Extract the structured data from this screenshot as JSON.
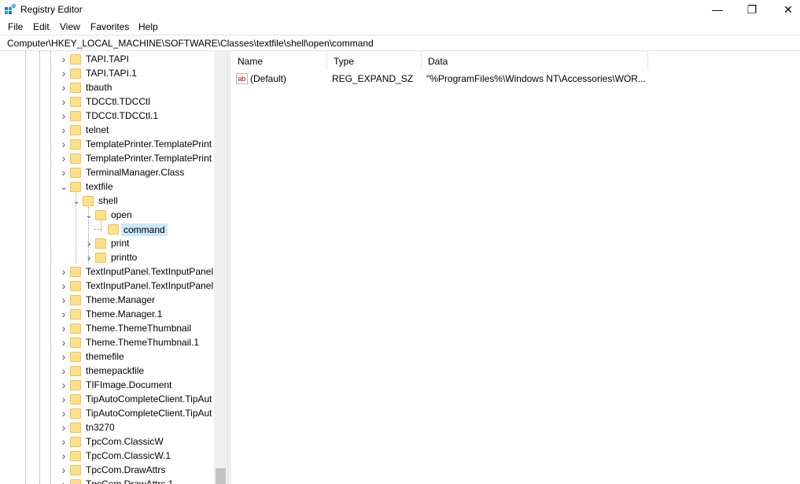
{
  "window": {
    "title": "Registry Editor",
    "controls": {
      "minimize": "—",
      "maximize": "❐",
      "close": "✕"
    }
  },
  "menu": [
    "File",
    "Edit",
    "View",
    "Favorites",
    "Help"
  ],
  "address": "Computer\\HKEY_LOCAL_MACHINE\\SOFTWARE\\Classes\\textfile\\shell\\open\\command",
  "tree": [
    {
      "label": "TAPI.TAPI",
      "level": 0,
      "expander": "collapsed"
    },
    {
      "label": "TAPI.TAPI.1",
      "level": 0,
      "expander": "collapsed"
    },
    {
      "label": "tbauth",
      "level": 0,
      "expander": "collapsed"
    },
    {
      "label": "TDCCtl.TDCCtl",
      "level": 0,
      "expander": "collapsed"
    },
    {
      "label": "TDCCtl.TDCCtl.1",
      "level": 0,
      "expander": "collapsed"
    },
    {
      "label": "telnet",
      "level": 0,
      "expander": "collapsed"
    },
    {
      "label": "TemplatePrinter.TemplatePrint",
      "level": 0,
      "expander": "collapsed"
    },
    {
      "label": "TemplatePrinter.TemplatePrint",
      "level": 0,
      "expander": "collapsed"
    },
    {
      "label": "TerminalManager.Class",
      "level": 0,
      "expander": "collapsed"
    },
    {
      "label": "textfile",
      "level": 0,
      "expander": "expanded"
    },
    {
      "label": "shell",
      "level": 1,
      "expander": "expanded"
    },
    {
      "label": "open",
      "level": 2,
      "expander": "expanded"
    },
    {
      "label": "command",
      "level": 3,
      "expander": "none",
      "selected": true
    },
    {
      "label": "print",
      "level": 2,
      "expander": "collapsed"
    },
    {
      "label": "printto",
      "level": 2,
      "expander": "collapsed"
    },
    {
      "label": "TextInputPanel.TextInputPanel",
      "level": 0,
      "expander": "collapsed"
    },
    {
      "label": "TextInputPanel.TextInputPanel.",
      "level": 0,
      "expander": "collapsed"
    },
    {
      "label": "Theme.Manager",
      "level": 0,
      "expander": "collapsed"
    },
    {
      "label": "Theme.Manager.1",
      "level": 0,
      "expander": "collapsed"
    },
    {
      "label": "Theme.ThemeThumbnail",
      "level": 0,
      "expander": "collapsed"
    },
    {
      "label": "Theme.ThemeThumbnail.1",
      "level": 0,
      "expander": "collapsed"
    },
    {
      "label": "themefile",
      "level": 0,
      "expander": "collapsed"
    },
    {
      "label": "themepackfile",
      "level": 0,
      "expander": "collapsed"
    },
    {
      "label": "TIFImage.Document",
      "level": 0,
      "expander": "collapsed"
    },
    {
      "label": "TipAutoCompleteClient.TipAut",
      "level": 0,
      "expander": "collapsed"
    },
    {
      "label": "TipAutoCompleteClient.TipAut",
      "level": 0,
      "expander": "collapsed"
    },
    {
      "label": "tn3270",
      "level": 0,
      "expander": "collapsed"
    },
    {
      "label": "TpcCom.ClassicW",
      "level": 0,
      "expander": "collapsed"
    },
    {
      "label": "TpcCom.ClassicW.1",
      "level": 0,
      "expander": "collapsed"
    },
    {
      "label": "TpcCom.DrawAttrs",
      "level": 0,
      "expander": "collapsed"
    },
    {
      "label": "TpcCom.DrawAttrs.1",
      "level": 0,
      "expander": "collapsed"
    }
  ],
  "list": {
    "columns": [
      "Name",
      "Type",
      "Data"
    ],
    "rows": [
      {
        "icon": "ab",
        "name": "(Default)",
        "type": "REG_EXPAND_SZ",
        "data": "\"%ProgramFiles%\\Windows NT\\Accessories\\WOR..."
      }
    ]
  }
}
